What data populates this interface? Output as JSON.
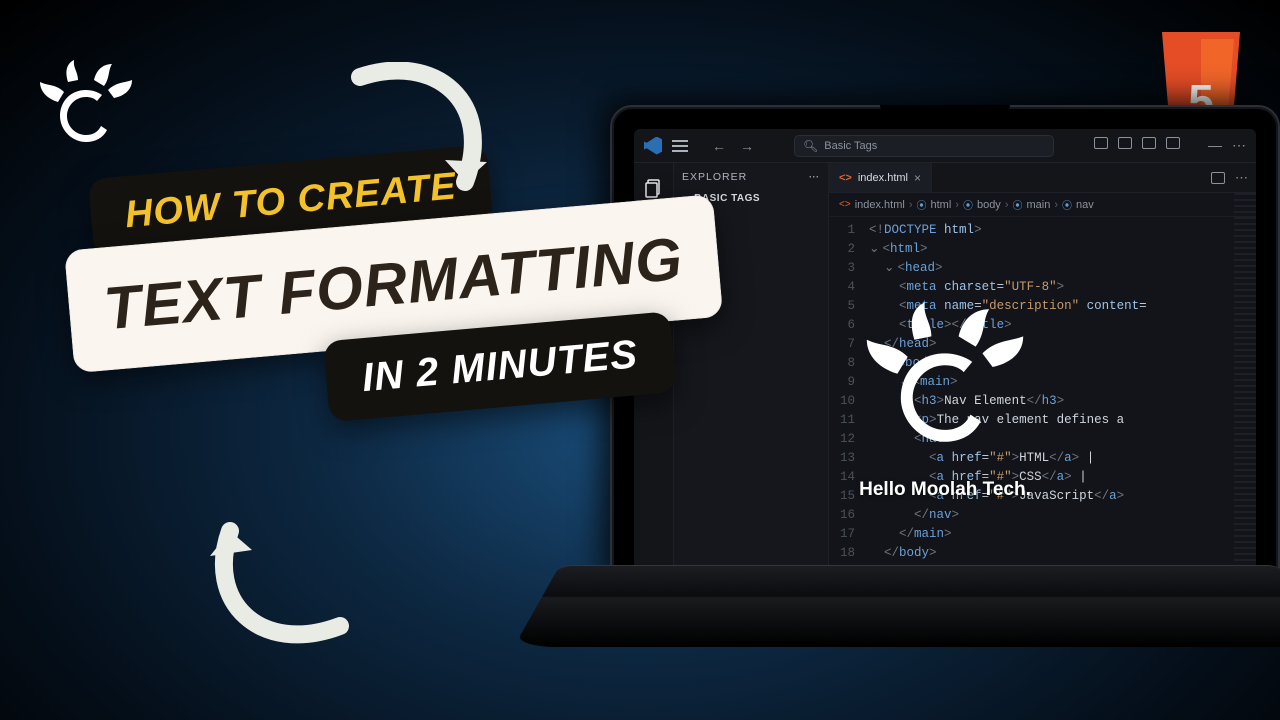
{
  "title_cards": {
    "line1": "HOW TO CREATE",
    "line2": "TEXT FORMATTING",
    "line3": "IN 2 MINUTES"
  },
  "html5_badge": {
    "label": "5"
  },
  "screen_overlay": {
    "caption": "Hello Moolah Tech."
  },
  "vscode": {
    "search_placeholder": "Basic Tags",
    "sidebar": {
      "title": "EXPLORER",
      "folder": "BASIC TAGS"
    },
    "tab": {
      "filename": "index.html"
    },
    "breadcrumbs": [
      "index.html",
      "html",
      "body",
      "main",
      "nav"
    ],
    "code": {
      "lines": [
        {
          "n": 1,
          "html": "<span class='tok-gray'>&lt;!</span><span class='tok-tag'>DOCTYPE</span> <span class='tok-attr'>html</span><span class='tok-gray'>&gt;</span>"
        },
        {
          "n": 2,
          "html": "<span class='fold'>⌄</span><span class='tok-gray'>&lt;</span><span class='tok-tag'>html</span><span class='tok-gray'>&gt;</span>"
        },
        {
          "n": 3,
          "html": "  <span class='fold'>⌄</span><span class='tok-gray'>&lt;</span><span class='tok-tag'>head</span><span class='tok-gray'>&gt;</span>"
        },
        {
          "n": 4,
          "html": "    <span class='tok-gray'>&lt;</span><span class='tok-tag'>meta</span> <span class='tok-attr'>charset</span>=<span class='tok-str'>\"UTF-8\"</span><span class='tok-gray'>&gt;</span>"
        },
        {
          "n": 5,
          "html": "    <span class='tok-gray'>&lt;</span><span class='tok-tag'>meta</span> <span class='tok-attr'>name</span>=<span class='tok-str'>\"description\"</span> <span class='tok-attr'>content</span>="
        },
        {
          "n": 6,
          "html": "    <span class='tok-gray'>&lt;</span><span class='tok-tag'>title</span><span class='tok-gray'>&gt;&lt;/</span><span class='tok-tag'>title</span><span class='tok-gray'>&gt;</span>"
        },
        {
          "n": 7,
          "html": "  <span class='tok-gray'>&lt;/</span><span class='tok-tag'>head</span><span class='tok-gray'>&gt;</span>"
        },
        {
          "n": 8,
          "html": "  <span class='fold'>⌄</span><span class='tok-gray'>&lt;</span><span class='tok-tag'>body</span><span class='tok-gray'>&gt;</span>"
        },
        {
          "n": 9,
          "html": "    <span class='fold'>⌄</span><span class='tok-gray'>&lt;</span><span class='tok-tag'>main</span><span class='tok-gray'>&gt;</span>"
        },
        {
          "n": 10,
          "html": "      <span class='tok-gray'>&lt;</span><span class='tok-tag'>h3</span><span class='tok-gray'>&gt;</span><span class='tok-txt'>Nav Element</span><span class='tok-gray'>&lt;/</span><span class='tok-tag'>h3</span><span class='tok-gray'>&gt;</span>"
        },
        {
          "n": 11,
          "html": "      <span class='tok-gray'>&lt;</span><span class='tok-tag'>p</span><span class='tok-gray'>&gt;</span><span class='tok-txt'>The nav element defines a</span>"
        },
        {
          "n": 12,
          "html": "      <span class='tok-gray'>&lt;</span><span class='tok-tag'>nav</span><span class='tok-gray'>&gt;</span>"
        },
        {
          "n": 13,
          "html": "        <span class='tok-gray'>&lt;</span><span class='tok-tag'>a</span> <span class='tok-attr'>href</span>=<span class='tok-str'>\"#\"</span><span class='tok-gray'>&gt;</span><span class='tok-txt'>HTML</span><span class='tok-gray'>&lt;/</span><span class='tok-tag'>a</span><span class='tok-gray'>&gt;</span> <span class='tok-txt'>|</span>"
        },
        {
          "n": 14,
          "html": "        <span class='tok-gray'>&lt;</span><span class='tok-tag'>a</span> <span class='tok-attr'>href</span>=<span class='tok-str'>\"#\"</span><span class='tok-gray'>&gt;</span><span class='tok-txt'>CSS</span><span class='tok-gray'>&lt;/</span><span class='tok-tag'>a</span><span class='tok-gray'>&gt;</span> <span class='tok-txt'>|</span>"
        },
        {
          "n": 15,
          "html": "        <span class='tok-gray'>&lt;</span><span class='tok-tag'>a</span> <span class='tok-attr'>href</span>=<span class='tok-str'>\"#\"</span><span class='tok-gray'>&gt;</span><span class='tok-txt'>JavaScript</span><span class='tok-gray'>&lt;/</span><span class='tok-tag'>a</span><span class='tok-gray'>&gt;</span>"
        },
        {
          "n": 16,
          "html": "      <span class='tok-gray'>&lt;/</span><span class='tok-tag'>nav</span><span class='tok-gray'>&gt;</span>"
        },
        {
          "n": 17,
          "html": "    <span class='tok-gray'>&lt;/</span><span class='tok-tag'>main</span><span class='tok-gray'>&gt;</span>"
        },
        {
          "n": 18,
          "html": "  <span class='tok-gray'>&lt;/</span><span class='tok-tag'>body</span><span class='tok-gray'>&gt;</span>"
        }
      ]
    }
  }
}
